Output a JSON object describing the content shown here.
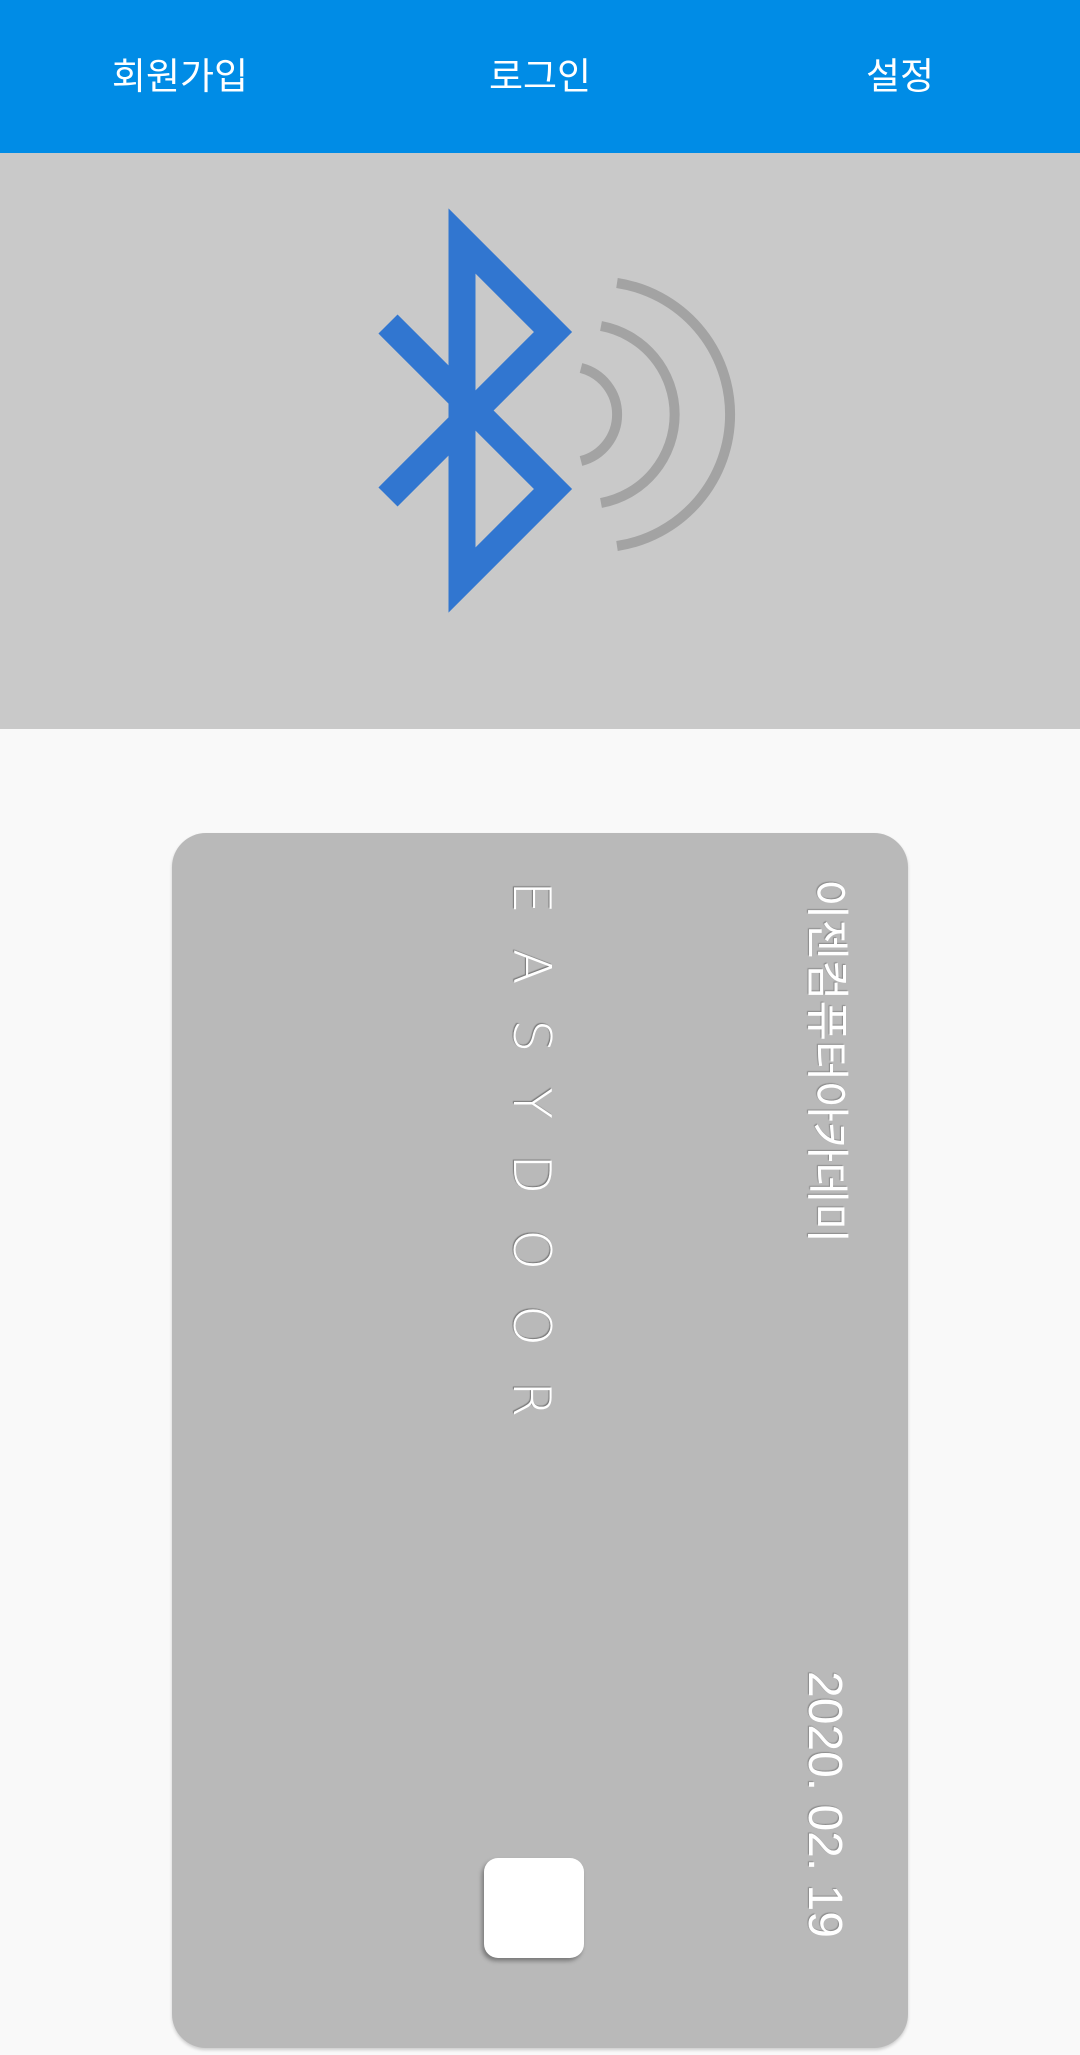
{
  "tabs": [
    {
      "label": "회원가입"
    },
    {
      "label": "로그인"
    },
    {
      "label": "설정"
    }
  ],
  "bluetooth": {
    "icon": "bluetooth-icon",
    "signal_icon": "signal-waves-icon",
    "icon_color": "#3176d0",
    "wave_color": "#a3a3a3"
  },
  "card": {
    "brand": "EASYDOOR",
    "company": "이젠컴퓨터아카데미",
    "date": "2020. 02. 19"
  },
  "colors": {
    "topbar": "#008ce6",
    "panel": "#c9c9c9",
    "card": "#b9b9b9",
    "background": "#f9f9f9"
  }
}
